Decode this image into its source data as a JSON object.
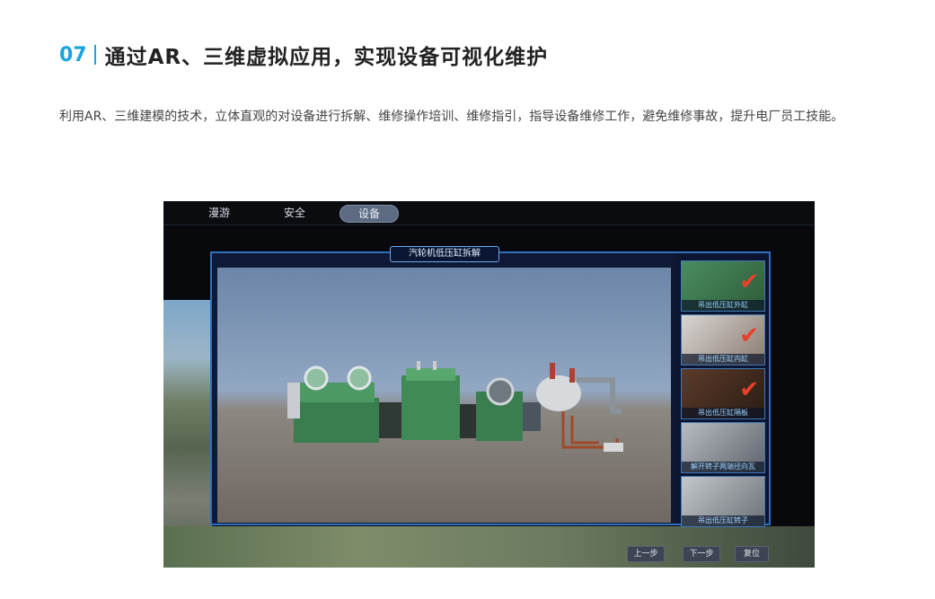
{
  "header": {
    "number": "07",
    "title": "通过AR、三维虚拟应用，实现设备可视化维护"
  },
  "intro": {
    "text": "利用AR、三维建模的技术，立体直观的对设备进行拆解、维修操作培训、维修指引，指导设备维修工作，避免维修事故，提升电厂员工技能。"
  },
  "app": {
    "nav": [
      {
        "label": "漫游"
      },
      {
        "label": "安全"
      },
      {
        "label": "设备",
        "active": true
      }
    ],
    "panel_title": "汽轮机低压缸拆解",
    "steps": [
      {
        "label": "吊出低压缸外缸",
        "done": true
      },
      {
        "label": "吊出低压缸内缸",
        "done": true
      },
      {
        "label": "吊出低压缸隔板",
        "done": true
      },
      {
        "label": "解开转子两端径向瓦",
        "done": false
      },
      {
        "label": "吊出低压缸转子",
        "done": false
      }
    ],
    "buttons": {
      "prev": "上一步",
      "next": "下一步",
      "reset": "复位"
    },
    "colors": {
      "accent": "#2f6fc0",
      "check": "#e8402a",
      "equipment": "#3f8a55"
    }
  }
}
